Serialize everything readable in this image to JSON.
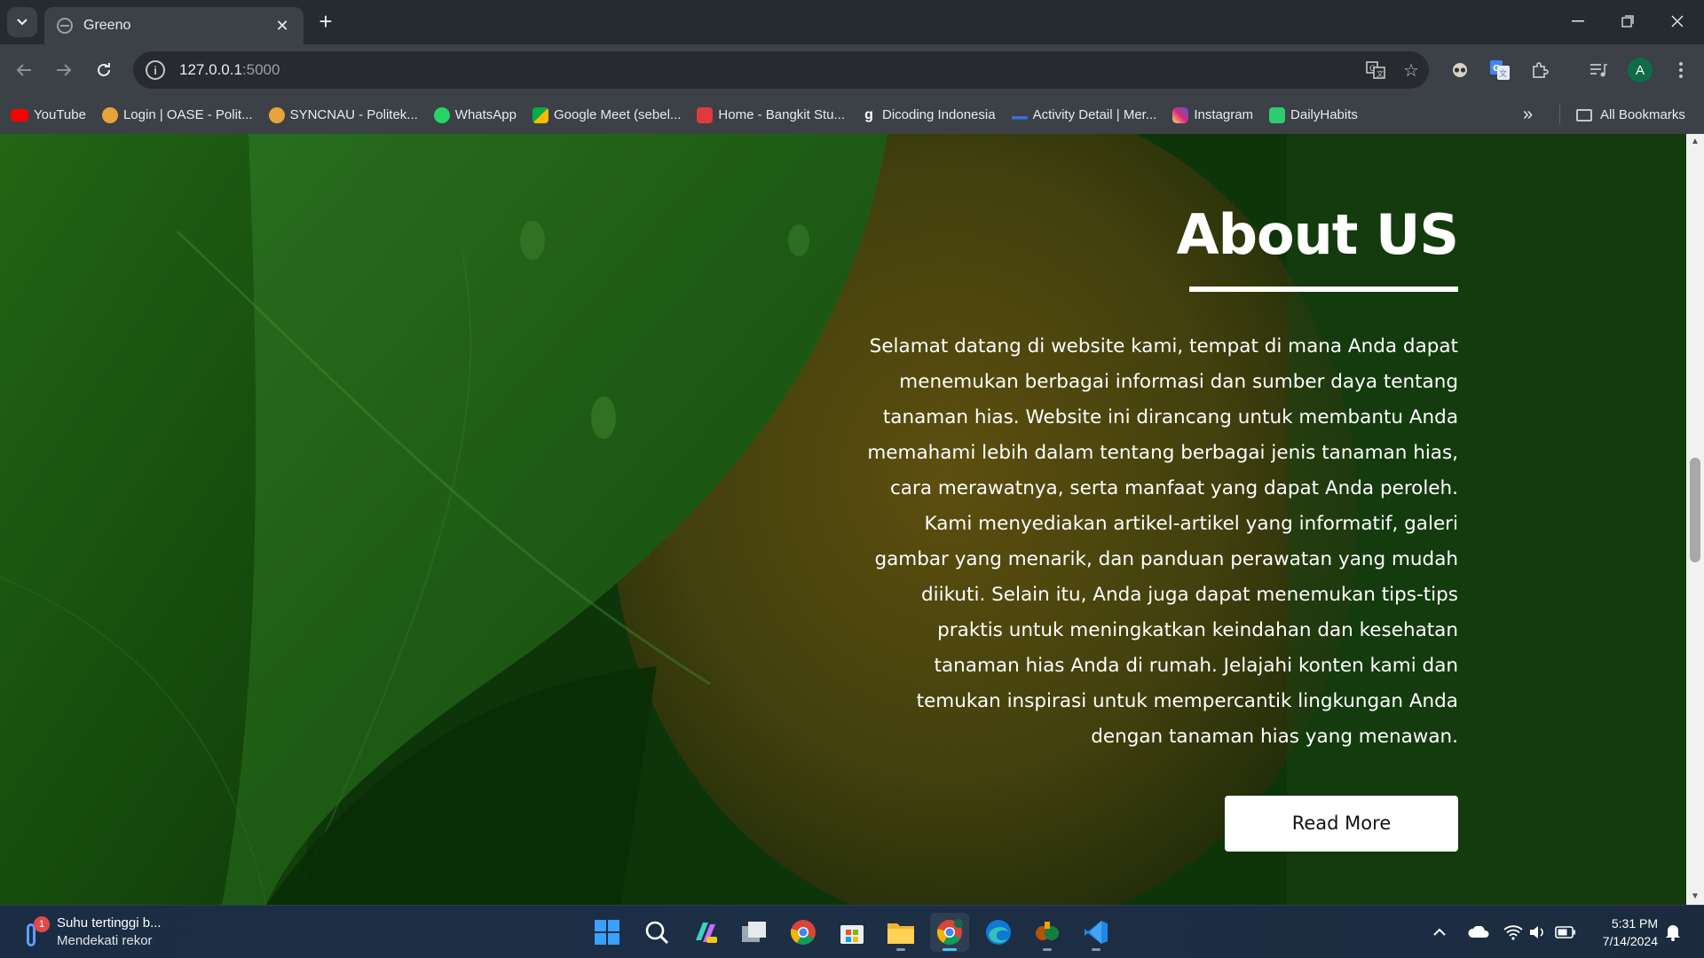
{
  "browser": {
    "tab_title": "Greeno",
    "url_host": "127.0.0.1",
    "url_port": ":5000",
    "profile_initial": "A"
  },
  "bookmarks": [
    {
      "label": "YouTube",
      "icon": "youtube-icon",
      "color": "#ff0000"
    },
    {
      "label": "Login | OASE - Polit...",
      "icon": "oase-icon",
      "color": "#e8a33a"
    },
    {
      "label": "SYNCNAU - Politek...",
      "icon": "syncnau-icon",
      "color": "#e8a33a"
    },
    {
      "label": "WhatsApp",
      "icon": "whatsapp-icon",
      "color": "#25d366"
    },
    {
      "label": "Google Meet (sebel...",
      "icon": "google-meet-icon",
      "color": "#00ac47"
    },
    {
      "label": "Home - Bangkit Stu...",
      "icon": "bangkit-icon",
      "color": "#e03a3a"
    },
    {
      "label": "Dicoding Indonesia",
      "icon": "dicoding-icon",
      "color": "#ffffff"
    },
    {
      "label": "Activity Detail | Mer...",
      "icon": "merdeka-icon",
      "color": "#3a6ed8"
    },
    {
      "label": "Instagram",
      "icon": "instagram-icon",
      "color": "#e1306c"
    },
    {
      "label": "DailyHabits",
      "icon": "dailyhabits-icon",
      "color": "#2ecc71"
    }
  ],
  "bookmarks_all": "All Bookmarks",
  "page": {
    "title": "About US",
    "body": "Selamat datang di website kami, tempat di mana Anda dapat menemukan berbagai informasi dan sumber daya tentang tanaman hias. Website ini dirancang untuk membantu Anda memahami lebih dalam tentang berbagai jenis tanaman hias, cara merawatnya, serta manfaat yang dapat Anda peroleh. Kami menyediakan artikel-artikel yang informatif, galeri gambar yang menarik, dan panduan perawatan yang mudah diikuti. Selain itu, Anda juga dapat menemukan tips-tips praktis untuk meningkatkan keindahan dan kesehatan tanaman hias Anda di rumah. Jelajahi konten kami dan temukan inspirasi untuk mempercantik lingkungan Anda dengan tanaman hias yang menawan.",
    "button_label": "Read More"
  },
  "taskbar": {
    "weather_title": "Suhu tertinggi b...",
    "weather_sub": "Mendekati rekor",
    "weather_badge": "1",
    "time": "5:31 PM",
    "date": "7/14/2024"
  },
  "colors": {
    "accent_green": "#1d6b12",
    "button_bg": "#ffffff",
    "taskbar_active": "#4cc2ff"
  }
}
